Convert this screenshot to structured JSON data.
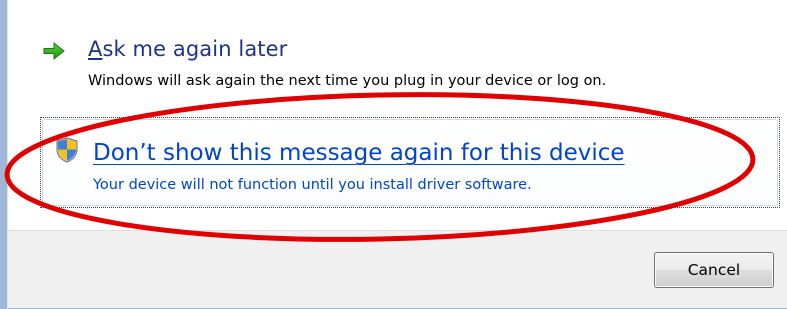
{
  "dialog": {
    "options": [
      {
        "title_accel": "A",
        "title_rest": "sk me again later",
        "description": "Windows will ask again the next time you plug in your device or log on.",
        "icon": "green-arrow-icon",
        "title_color": "#1e3287"
      },
      {
        "title": "Don’t show this message again for this device",
        "description": "Your device will not function until you install driver software.",
        "icon": "uac-shield-icon",
        "title_color": "#0044cc",
        "focused": true
      }
    ],
    "cancel_label": "Cancel"
  },
  "annotation": {
    "shape": "ellipse",
    "color": "#e00000"
  }
}
